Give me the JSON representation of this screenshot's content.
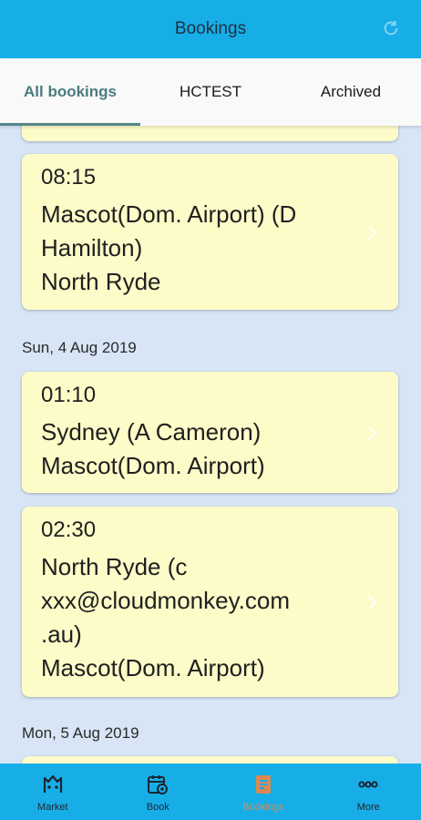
{
  "header": {
    "title": "Bookings",
    "right_icon": "refresh-icon"
  },
  "tabs": [
    {
      "label": "All bookings",
      "active": true
    },
    {
      "label": "HCTEST",
      "active": false
    },
    {
      "label": "Archived",
      "active": false
    }
  ],
  "bookings": {
    "group1": {
      "cards": [
        {
          "time": "08:15",
          "lines": [
            "Mascot(Dom. Airport) (D",
            "Hamilton)",
            "North Ryde"
          ]
        }
      ]
    },
    "group2": {
      "date": "Sun, 4 Aug 2019",
      "cards": [
        {
          "time": "01:10",
          "lines": [
            "Sydney (A Cameron)",
            "Mascot(Dom. Airport)"
          ]
        },
        {
          "time": "02:30",
          "lines": [
            "North Ryde (c",
            "xxx@cloudmonkey.com",
            ".au)",
            "Mascot(Dom. Airport)"
          ]
        }
      ]
    },
    "group3": {
      "date": "Mon, 5 Aug 2019"
    }
  },
  "bottom_nav": [
    {
      "label": "Market",
      "icon": "market-icon",
      "active": false
    },
    {
      "label": "Book",
      "icon": "book-icon",
      "active": false
    },
    {
      "label": "Bookings",
      "icon": "bookings-icon",
      "active": true
    },
    {
      "label": "More",
      "icon": "more-icon",
      "active": false
    }
  ],
  "colors": {
    "header": "#17aee8",
    "card": "#fdfbc8",
    "background": "#d7e5f6",
    "active_tab": "#4b7c80",
    "active_nav": "#d98a52"
  }
}
